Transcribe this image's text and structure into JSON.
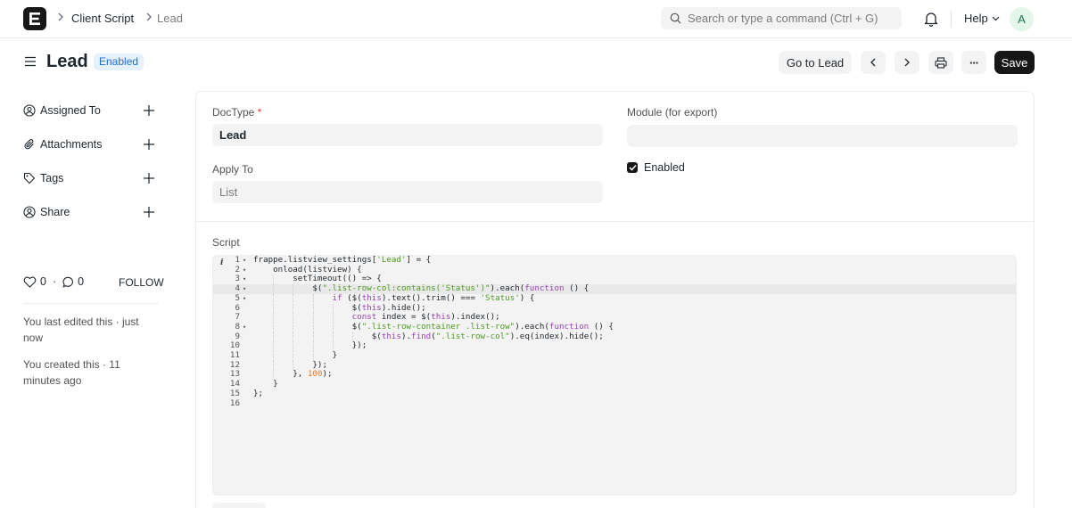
{
  "navbar": {
    "logo_letter": "E",
    "breadcrumbs": [
      "Client Script",
      "Lead"
    ],
    "search_placeholder": "Search or type a command (Ctrl + G)",
    "help_label": "Help",
    "avatar_initial": "A"
  },
  "page": {
    "title": "Lead",
    "status_badge": "Enabled",
    "buttons": {
      "go_to": "Go to Lead",
      "more": "···",
      "save": "Save"
    }
  },
  "sidebar": {
    "items": [
      {
        "label": "Assigned To",
        "icon": "assign-icon"
      },
      {
        "label": "Attachments",
        "icon": "paperclip-icon"
      },
      {
        "label": "Tags",
        "icon": "tag-icon"
      },
      {
        "label": "Share",
        "icon": "share-icon"
      }
    ],
    "likes_count": "0",
    "comments_count": "0",
    "follow_label": "FOLLOW",
    "activity": [
      "You last edited this · just now",
      "You created this · 11 minutes ago"
    ]
  },
  "form": {
    "doctype_label": "DocType",
    "doctype_required_mark": "*",
    "doctype_value": "Lead",
    "module_label": "Module (for export)",
    "module_value": "",
    "apply_to_label": "Apply To",
    "apply_to_value": "List",
    "enabled_label": "Enabled",
    "enabled_checked": true,
    "script_label": "Script"
  },
  "code_lines": [
    "frappe.listview_settings['Lead'] = {",
    "    onload(listview) {",
    "        setTimeout(() => {",
    "            $(\".list-row-col:contains('Status')\").each(function () {",
    "                if ($(this).text().trim() === 'Status') {",
    "                    $(this).hide();",
    "                    const index = $(this).index();",
    "                    $(\".list-row-container .list-row\").each(function () {",
    "                        $(this).find(\".list-row-col\").eq(index).hide();",
    "                    });",
    "                }",
    "            });",
    "        }, 100);",
    "    }",
    "};",
    ""
  ],
  "colors": {
    "primary": "#171717",
    "badge_bg": "#e6f1fe",
    "badge_text": "#1f6fcb",
    "field_bg": "#f3f3f3",
    "string": "#4d9a1f",
    "keyword": "#9a3fb5",
    "number": "#e47a27"
  }
}
